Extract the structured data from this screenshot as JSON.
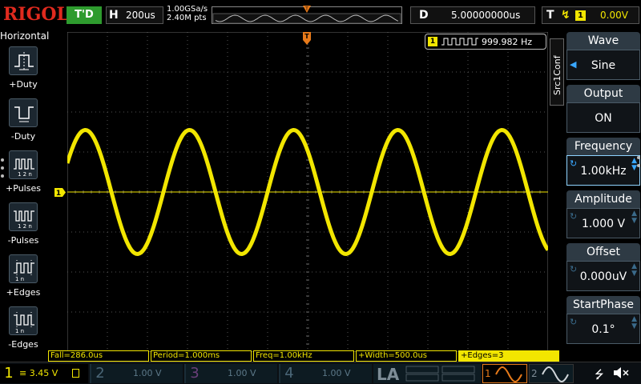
{
  "topbar": {
    "brand": "RIGOL",
    "run_status": "T'D",
    "horizontal": {
      "label": "H",
      "value": "200us"
    },
    "sample_rate": "1.00GSa/s",
    "memory_depth": "2.40M pts",
    "delay": {
      "label": "D",
      "value": "5.00000000us"
    },
    "trigger": {
      "label": "T",
      "source": "1",
      "level": "0.00V"
    }
  },
  "left_menu": {
    "title": "Horizontal",
    "items": [
      {
        "label": "+Duty",
        "icon": "positive-duty-icon"
      },
      {
        "label": "-Duty",
        "icon": "negative-duty-icon"
      },
      {
        "label": "+Pulses",
        "icon": "positive-pulses-icon"
      },
      {
        "label": "-Pulses",
        "icon": "negative-pulses-icon"
      },
      {
        "label": "+Edges",
        "icon": "rising-edges-icon"
      },
      {
        "label": "-Edges",
        "icon": "falling-edges-icon"
      }
    ]
  },
  "counter": {
    "channel": "1",
    "value": "999.982 Hz"
  },
  "ch1_marker": "1",
  "right_menu": {
    "tab": "Src1Conf",
    "items": [
      {
        "label": "Wave",
        "value": "Sine"
      },
      {
        "label": "Output",
        "value": "ON"
      },
      {
        "label": "Frequency",
        "value": "1.00kHz"
      },
      {
        "label": "Amplitude",
        "value": "1.000 V"
      },
      {
        "label": "Offset",
        "value": "0.000uV"
      },
      {
        "label": "StartPhase",
        "value": "0.1°"
      }
    ]
  },
  "measurements": [
    "Fall=286.0us",
    "Period=1.000ms",
    "Freq=1.00kHz",
    "+Width=500.0us",
    "+Edges=3"
  ],
  "bottombar": {
    "ch1": {
      "num": "1",
      "value": "3.45 V"
    },
    "ch2": {
      "num": "2",
      "value": "1.00 V"
    },
    "ch3": {
      "num": "3",
      "value": "1.00 V"
    },
    "ch4": {
      "num": "4",
      "value": "1.00 V"
    },
    "la": "LA",
    "gen1": "1",
    "gen2": "2"
  },
  "colors": {
    "ch1": "#f2e600",
    "brand": "#e02a1e",
    "run": "#2e9b2e",
    "accent": "#39a7ff",
    "trigger_marker": "#e77a1a"
  },
  "waveform": {
    "type": "sine",
    "period_div": 2.6,
    "amplitude_div": 1.55,
    "phase_div": 1.75
  }
}
